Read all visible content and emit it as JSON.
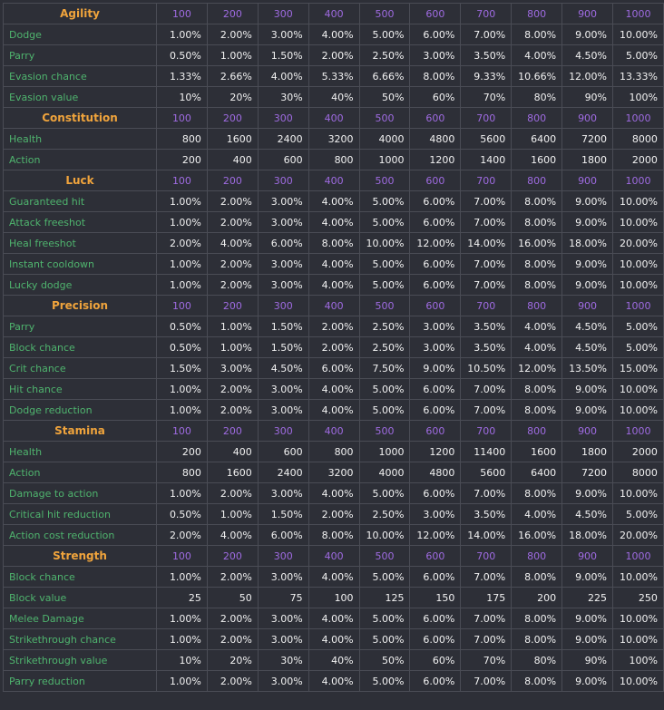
{
  "levels": [
    "100",
    "200",
    "300",
    "400",
    "500",
    "600",
    "700",
    "800",
    "900",
    "1000"
  ],
  "sections": [
    {
      "title": "Agility",
      "rows": [
        {
          "label": "Dodge",
          "values": [
            "1.00%",
            "2.00%",
            "3.00%",
            "4.00%",
            "5.00%",
            "6.00%",
            "7.00%",
            "8.00%",
            "9.00%",
            "10.00%"
          ]
        },
        {
          "label": "Parry",
          "values": [
            "0.50%",
            "1.00%",
            "1.50%",
            "2.00%",
            "2.50%",
            "3.00%",
            "3.50%",
            "4.00%",
            "4.50%",
            "5.00%"
          ]
        },
        {
          "label": "Evasion chance",
          "values": [
            "1.33%",
            "2.66%",
            "4.00%",
            "5.33%",
            "6.66%",
            "8.00%",
            "9.33%",
            "10.66%",
            "12.00%",
            "13.33%"
          ]
        },
        {
          "label": "Evasion value",
          "values": [
            "10%",
            "20%",
            "30%",
            "40%",
            "50%",
            "60%",
            "70%",
            "80%",
            "90%",
            "100%"
          ]
        }
      ]
    },
    {
      "title": "Constitution",
      "rows": [
        {
          "label": "Health",
          "values": [
            "800",
            "1600",
            "2400",
            "3200",
            "4000",
            "4800",
            "5600",
            "6400",
            "7200",
            "8000"
          ]
        },
        {
          "label": "Action",
          "values": [
            "200",
            "400",
            "600",
            "800",
            "1000",
            "1200",
            "1400",
            "1600",
            "1800",
            "2000"
          ]
        }
      ]
    },
    {
      "title": "Luck",
      "rows": [
        {
          "label": "Guaranteed hit",
          "values": [
            "1.00%",
            "2.00%",
            "3.00%",
            "4.00%",
            "5.00%",
            "6.00%",
            "7.00%",
            "8.00%",
            "9.00%",
            "10.00%"
          ]
        },
        {
          "label": "Attack freeshot",
          "values": [
            "1.00%",
            "2.00%",
            "3.00%",
            "4.00%",
            "5.00%",
            "6.00%",
            "7.00%",
            "8.00%",
            "9.00%",
            "10.00%"
          ]
        },
        {
          "label": "Heal freeshot",
          "values": [
            "2.00%",
            "4.00%",
            "6.00%",
            "8.00%",
            "10.00%",
            "12.00%",
            "14.00%",
            "16.00%",
            "18.00%",
            "20.00%"
          ]
        },
        {
          "label": "Instant cooldown",
          "values": [
            "1.00%",
            "2.00%",
            "3.00%",
            "4.00%",
            "5.00%",
            "6.00%",
            "7.00%",
            "8.00%",
            "9.00%",
            "10.00%"
          ]
        },
        {
          "label": "Lucky dodge",
          "values": [
            "1.00%",
            "2.00%",
            "3.00%",
            "4.00%",
            "5.00%",
            "6.00%",
            "7.00%",
            "8.00%",
            "9.00%",
            "10.00%"
          ]
        }
      ]
    },
    {
      "title": "Precision",
      "rows": [
        {
          "label": "Parry",
          "values": [
            "0.50%",
            "1.00%",
            "1.50%",
            "2.00%",
            "2.50%",
            "3.00%",
            "3.50%",
            "4.00%",
            "4.50%",
            "5.00%"
          ]
        },
        {
          "label": "Block chance",
          "values": [
            "0.50%",
            "1.00%",
            "1.50%",
            "2.00%",
            "2.50%",
            "3.00%",
            "3.50%",
            "4.00%",
            "4.50%",
            "5.00%"
          ]
        },
        {
          "label": "Crit chance",
          "values": [
            "1.50%",
            "3.00%",
            "4.50%",
            "6.00%",
            "7.50%",
            "9.00%",
            "10.50%",
            "12.00%",
            "13.50%",
            "15.00%"
          ]
        },
        {
          "label": "Hit chance",
          "values": [
            "1.00%",
            "2.00%",
            "3.00%",
            "4.00%",
            "5.00%",
            "6.00%",
            "7.00%",
            "8.00%",
            "9.00%",
            "10.00%"
          ]
        },
        {
          "label": "Dodge reduction",
          "values": [
            "1.00%",
            "2.00%",
            "3.00%",
            "4.00%",
            "5.00%",
            "6.00%",
            "7.00%",
            "8.00%",
            "9.00%",
            "10.00%"
          ]
        }
      ]
    },
    {
      "title": "Stamina",
      "rows": [
        {
          "label": "Health",
          "values": [
            "200",
            "400",
            "600",
            "800",
            "1000",
            "1200",
            "11400",
            "1600",
            "1800",
            "2000"
          ]
        },
        {
          "label": "Action",
          "values": [
            "800",
            "1600",
            "2400",
            "3200",
            "4000",
            "4800",
            "5600",
            "6400",
            "7200",
            "8000"
          ]
        },
        {
          "label": "Damage to action",
          "values": [
            "1.00%",
            "2.00%",
            "3.00%",
            "4.00%",
            "5.00%",
            "6.00%",
            "7.00%",
            "8.00%",
            "9.00%",
            "10.00%"
          ]
        },
        {
          "label": "Critical hit reduction",
          "values": [
            "0.50%",
            "1.00%",
            "1.50%",
            "2.00%",
            "2.50%",
            "3.00%",
            "3.50%",
            "4.00%",
            "4.50%",
            "5.00%"
          ]
        },
        {
          "label": "Action cost reduction",
          "values": [
            "2.00%",
            "4.00%",
            "6.00%",
            "8.00%",
            "10.00%",
            "12.00%",
            "14.00%",
            "16.00%",
            "18.00%",
            "20.00%"
          ]
        }
      ]
    },
    {
      "title": "Strength",
      "rows": [
        {
          "label": "Block chance",
          "values": [
            "1.00%",
            "2.00%",
            "3.00%",
            "4.00%",
            "5.00%",
            "6.00%",
            "7.00%",
            "8.00%",
            "9.00%",
            "10.00%"
          ]
        },
        {
          "label": "Block value",
          "values": [
            "25",
            "50",
            "75",
            "100",
            "125",
            "150",
            "175",
            "200",
            "225",
            "250"
          ]
        },
        {
          "label": "Melee Damage",
          "values": [
            "1.00%",
            "2.00%",
            "3.00%",
            "4.00%",
            "5.00%",
            "6.00%",
            "7.00%",
            "8.00%",
            "9.00%",
            "10.00%"
          ]
        },
        {
          "label": "Strikethrough chance",
          "values": [
            "1.00%",
            "2.00%",
            "3.00%",
            "4.00%",
            "5.00%",
            "6.00%",
            "7.00%",
            "8.00%",
            "9.00%",
            "10.00%"
          ]
        },
        {
          "label": "Strikethrough value",
          "values": [
            "10%",
            "20%",
            "30%",
            "40%",
            "50%",
            "60%",
            "70%",
            "80%",
            "90%",
            "100%"
          ]
        },
        {
          "label": "Parry reduction",
          "values": [
            "1.00%",
            "2.00%",
            "3.00%",
            "4.00%",
            "5.00%",
            "6.00%",
            "7.00%",
            "8.00%",
            "9.00%",
            "10.00%"
          ]
        }
      ]
    }
  ]
}
